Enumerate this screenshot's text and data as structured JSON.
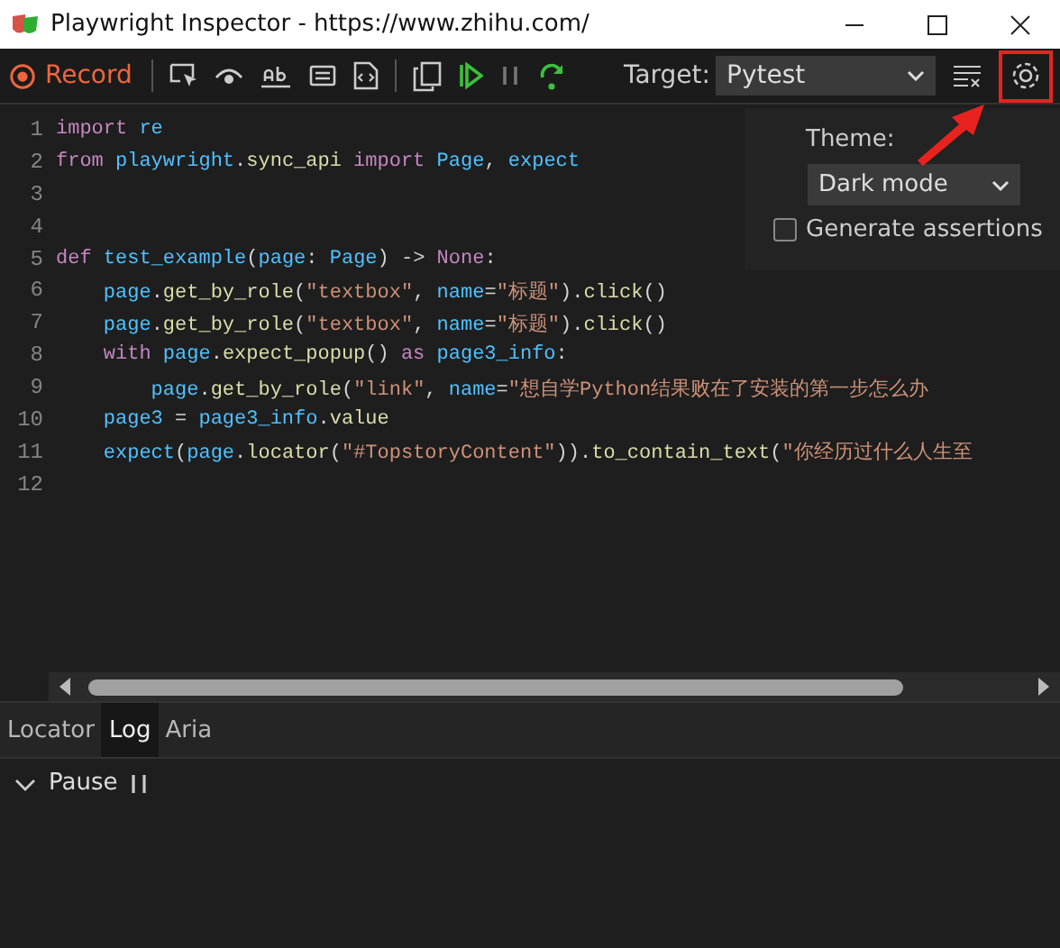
{
  "window": {
    "title": "Playwright Inspector - https://www.zhihu.com/"
  },
  "toolbar": {
    "record": "Record",
    "target_label": "Target:",
    "target": "Pytest"
  },
  "code": {
    "lines": [
      {
        "number": "1",
        "tokens": [
          {
            "kind": "keyword",
            "text": "import"
          },
          {
            "kind": "name",
            "text": " re"
          }
        ]
      },
      {
        "number": "2",
        "tokens": [
          {
            "kind": "keyword",
            "text": "from"
          },
          {
            "kind": "name",
            "text": " playwright"
          },
          {
            "kind": "plain",
            "text": "."
          },
          {
            "kind": "func",
            "text": "sync_api"
          },
          {
            "kind": "keyword",
            "text": " import"
          },
          {
            "kind": "name",
            "text": " Page"
          },
          {
            "kind": "plain",
            "text": ","
          },
          {
            "kind": "name",
            "text": " expect"
          }
        ]
      },
      {
        "number": "3"
      },
      {
        "number": "4"
      },
      {
        "number": "5",
        "tokens": [
          {
            "kind": "keyword",
            "text": "def"
          },
          {
            "kind": "name",
            "text": " test_example"
          },
          {
            "kind": "plain",
            "text": "("
          },
          {
            "kind": "name",
            "text": "page"
          },
          {
            "kind": "plain",
            "text": ":"
          },
          {
            "kind": "name",
            "text": " Page"
          },
          {
            "kind": "plain",
            "text": ") ->"
          },
          {
            "kind": "keyword",
            "text": " None"
          },
          {
            "kind": "plain",
            "text": ":"
          }
        ]
      },
      {
        "number": "6",
        "tokens": [
          {
            "kind": "name",
            "text": "    page"
          },
          {
            "kind": "plain",
            "text": "."
          },
          {
            "kind": "func",
            "text": "get_by_role"
          },
          {
            "kind": "plain",
            "text": "("
          },
          {
            "kind": "string",
            "text": "\"textbox\""
          },
          {
            "kind": "plain",
            "text": ","
          },
          {
            "kind": "name",
            "text": " name"
          },
          {
            "kind": "plain",
            "text": "="
          },
          {
            "kind": "string",
            "text": "\"标题\""
          },
          {
            "kind": "plain",
            "text": ")."
          },
          {
            "kind": "func",
            "text": "click"
          },
          {
            "kind": "plain",
            "text": "()"
          }
        ]
      },
      {
        "number": "7",
        "tokens": [
          {
            "kind": "name",
            "text": "    page"
          },
          {
            "kind": "plain",
            "text": "."
          },
          {
            "kind": "func",
            "text": "get_by_role"
          },
          {
            "kind": "plain",
            "text": "("
          },
          {
            "kind": "string",
            "text": "\"textbox\""
          },
          {
            "kind": "plain",
            "text": ","
          },
          {
            "kind": "name",
            "text": " name"
          },
          {
            "kind": "plain",
            "text": "="
          },
          {
            "kind": "string",
            "text": "\"标题\""
          },
          {
            "kind": "plain",
            "text": ")."
          },
          {
            "kind": "func",
            "text": "click"
          },
          {
            "kind": "plain",
            "text": "()"
          }
        ]
      },
      {
        "number": "8",
        "tokens": [
          {
            "kind": "keyword",
            "text": "    with"
          },
          {
            "kind": "name",
            "text": " page"
          },
          {
            "kind": "plain",
            "text": "."
          },
          {
            "kind": "func",
            "text": "expect_popup"
          },
          {
            "kind": "plain",
            "text": "()"
          },
          {
            "kind": "keyword",
            "text": " as"
          },
          {
            "kind": "name",
            "text": " page3_info"
          },
          {
            "kind": "plain",
            "text": ":"
          }
        ]
      },
      {
        "number": "9",
        "tokens": [
          {
            "kind": "name",
            "text": "        page"
          },
          {
            "kind": "plain",
            "text": "."
          },
          {
            "kind": "func",
            "text": "get_by_role"
          },
          {
            "kind": "plain",
            "text": "("
          },
          {
            "kind": "string",
            "text": "\"link\""
          },
          {
            "kind": "plain",
            "text": ","
          },
          {
            "kind": "name",
            "text": " name"
          },
          {
            "kind": "plain",
            "text": "="
          },
          {
            "kind": "string",
            "text": "\"想自学Python结果败在了安装的第一步怎么办"
          }
        ]
      },
      {
        "number": "10",
        "tokens": [
          {
            "kind": "name",
            "text": "    page3"
          },
          {
            "kind": "plain",
            "text": " ="
          },
          {
            "kind": "name",
            "text": " page3_info"
          },
          {
            "kind": "plain",
            "text": "."
          },
          {
            "kind": "func",
            "text": "value"
          }
        ]
      },
      {
        "number": "11",
        "tokens": [
          {
            "kind": "name",
            "text": "    expect"
          },
          {
            "kind": "plain",
            "text": "("
          },
          {
            "kind": "name",
            "text": "page"
          },
          {
            "kind": "plain",
            "text": "."
          },
          {
            "kind": "func",
            "text": "locator"
          },
          {
            "kind": "plain",
            "text": "("
          },
          {
            "kind": "string",
            "text": "\"#TopstoryContent\""
          },
          {
            "kind": "plain",
            "text": "))."
          },
          {
            "kind": "func",
            "text": "to_contain_text"
          },
          {
            "kind": "plain",
            "text": "("
          },
          {
            "kind": "string",
            "text": "\"你经历过什么人生至"
          }
        ]
      },
      {
        "number": "12"
      }
    ]
  },
  "settings": {
    "theme_label": "Theme:",
    "theme": "Dark mode",
    "generate_assertions": {
      "label": "Generate assertions",
      "checked": false
    }
  },
  "tabs": [
    {
      "label": "Locator",
      "selected": false
    },
    {
      "label": "Log",
      "selected": true
    },
    {
      "label": "Aria",
      "selected": false
    }
  ],
  "log": [
    {
      "label": "Pause",
      "expanded": true
    }
  ]
}
